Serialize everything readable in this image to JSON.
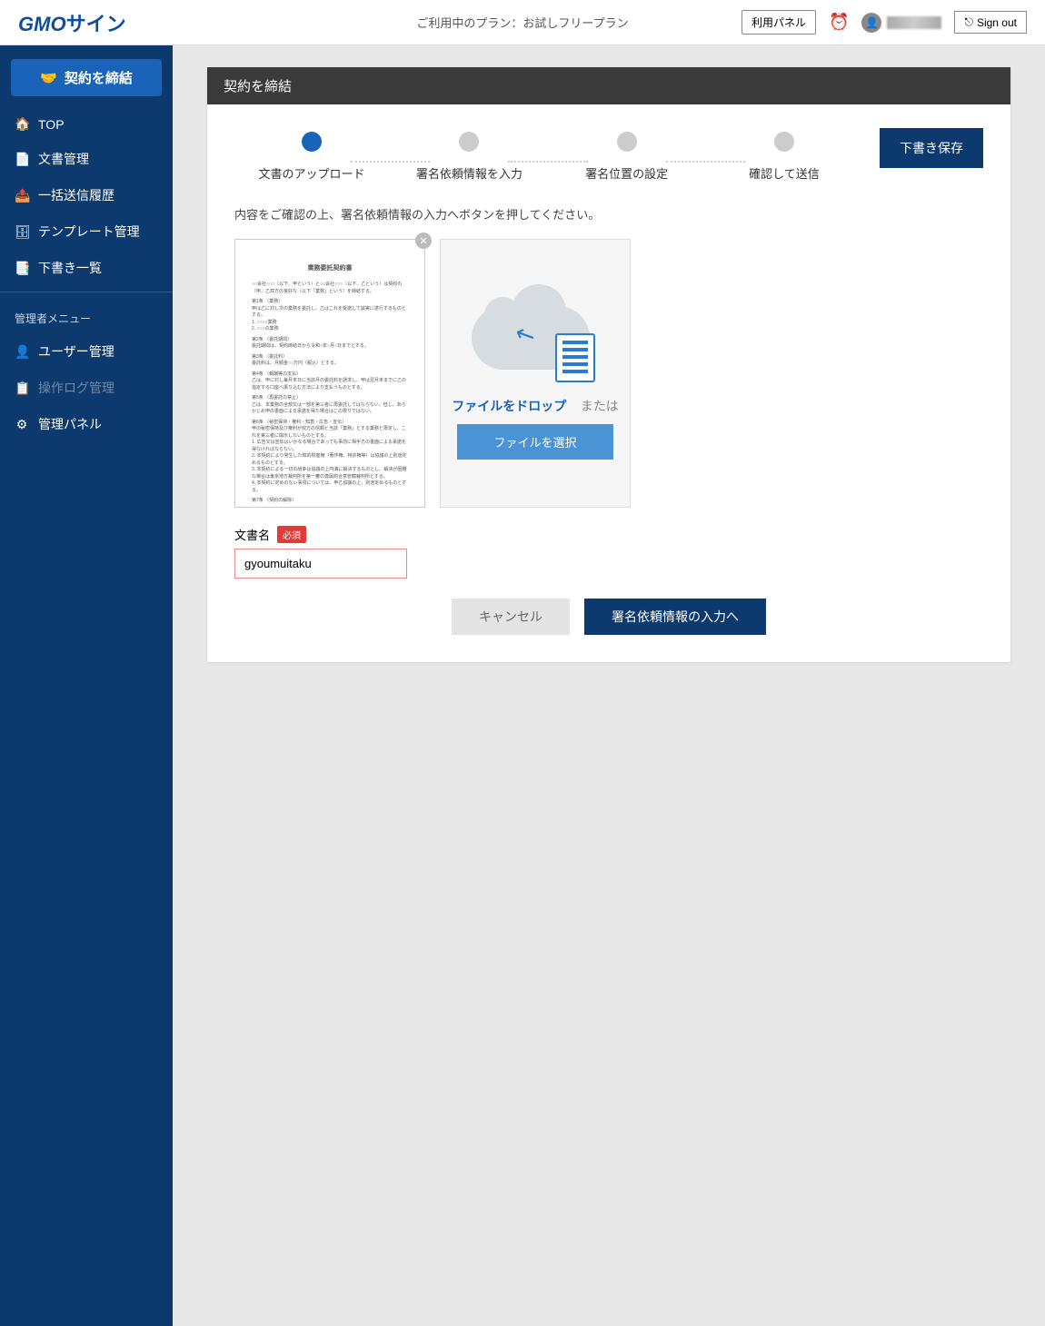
{
  "header": {
    "logo_gmo": "GMO",
    "logo_sign": "サイン",
    "plan_text": "ご利用中のプラン：お試しフリープラン",
    "usage_panel_btn": "利用パネル",
    "signout_label": "Sign out"
  },
  "sidebar": {
    "create_btn": "契約を締結",
    "items": [
      {
        "icon": "🏠",
        "label": "TOP"
      },
      {
        "icon": "📄",
        "label": "文書管理"
      },
      {
        "icon": "📤",
        "label": "一括送信履歴"
      },
      {
        "icon": "🗄",
        "label": "テンプレート管理"
      },
      {
        "icon": "📑",
        "label": "下書き一覧"
      }
    ],
    "admin_header": "管理者メニュー",
    "admin_items": [
      {
        "icon": "👤",
        "label": "ユーザー管理",
        "disabled": false
      },
      {
        "icon": "📋",
        "label": "操作ログ管理",
        "disabled": true
      },
      {
        "icon": "⚙",
        "label": "管理パネル",
        "disabled": false
      }
    ]
  },
  "panel": {
    "title": "契約を締結",
    "steps": [
      "文書のアップロード",
      "署名依頼情報を入力",
      "署名位置の設定",
      "確認して送信"
    ],
    "save_draft": "下書き保存",
    "instruction": "内容をご確認の上、署名依頼情報の入力へボタンを押してください。",
    "doc_preview_title": "業務委託契約書",
    "drop_text_blue": "ファイルをドロップ",
    "drop_text_or": "または",
    "file_select_btn": "ファイルを選択",
    "field_label": "文書名",
    "required_label": "必須",
    "input_value": "gyoumuitaku",
    "cancel_btn": "キャンセル",
    "next_btn": "署名依頼情報の入力へ"
  }
}
